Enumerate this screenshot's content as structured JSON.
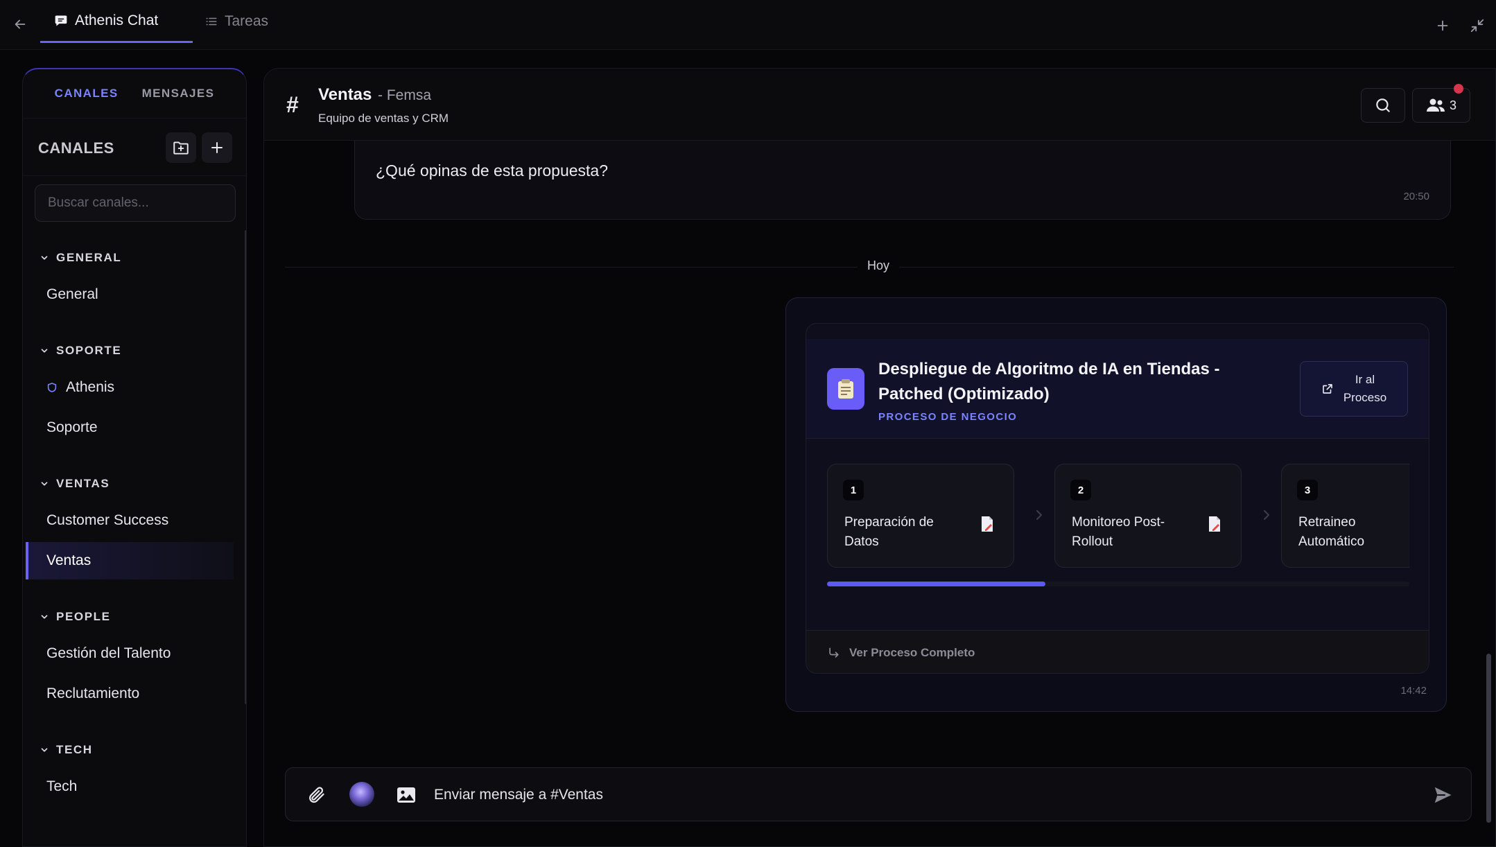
{
  "topbar": {
    "tabs": [
      {
        "label": "Athenis Chat"
      },
      {
        "label": "Tareas"
      }
    ]
  },
  "sidebar": {
    "tabs": [
      {
        "label": "CANALES"
      },
      {
        "label": "MENSAJES"
      }
    ],
    "title": "CANALES",
    "search_placeholder": "Buscar canales...",
    "sections": [
      {
        "label": "GENERAL",
        "items": [
          {
            "label": "General"
          }
        ]
      },
      {
        "label": "SOPORTE",
        "items": [
          {
            "label": "Athenis"
          },
          {
            "label": "Soporte"
          }
        ]
      },
      {
        "label": "VENTAS",
        "items": [
          {
            "label": "Customer Success"
          },
          {
            "label": "Ventas"
          }
        ]
      },
      {
        "label": "PEOPLE",
        "items": [
          {
            "label": "Gestión del Talento"
          },
          {
            "label": "Reclutamiento"
          }
        ]
      },
      {
        "label": "TECH",
        "items": [
          {
            "label": "Tech"
          }
        ]
      }
    ],
    "active_item": "Ventas"
  },
  "channel": {
    "name": "Ventas",
    "org": "- Femsa",
    "description": "Equipo de ventas y CRM",
    "member_count": "3"
  },
  "messages": {
    "previous": {
      "text": "¿Qué opinas de esta propuesta?",
      "time": "20:50"
    },
    "day_separator": "Hoy",
    "process_message": {
      "title": "Despliegue de Algoritmo de IA en Tiendas - Patched (Optimizado)",
      "kind": "PROCESO DE NEGOCIO",
      "go_label_line1": "Ir al",
      "go_label_line2": "Proceso",
      "steps": [
        {
          "num": "1",
          "label": "Preparación de Datos"
        },
        {
          "num": "2",
          "label": "Monitoreo Post-Rollout"
        },
        {
          "num": "3",
          "label": "Retraineo Automático"
        }
      ],
      "progress_fraction": 0.375,
      "footer_link": "Ver Proceso Completo",
      "time": "14:42"
    }
  },
  "composer": {
    "placeholder": "Enviar mensaje a #Ventas"
  },
  "colors": {
    "accent": "#6a63f5",
    "accent_text": "#7b83ff",
    "notification": "#d6354c",
    "background": "#060608"
  }
}
